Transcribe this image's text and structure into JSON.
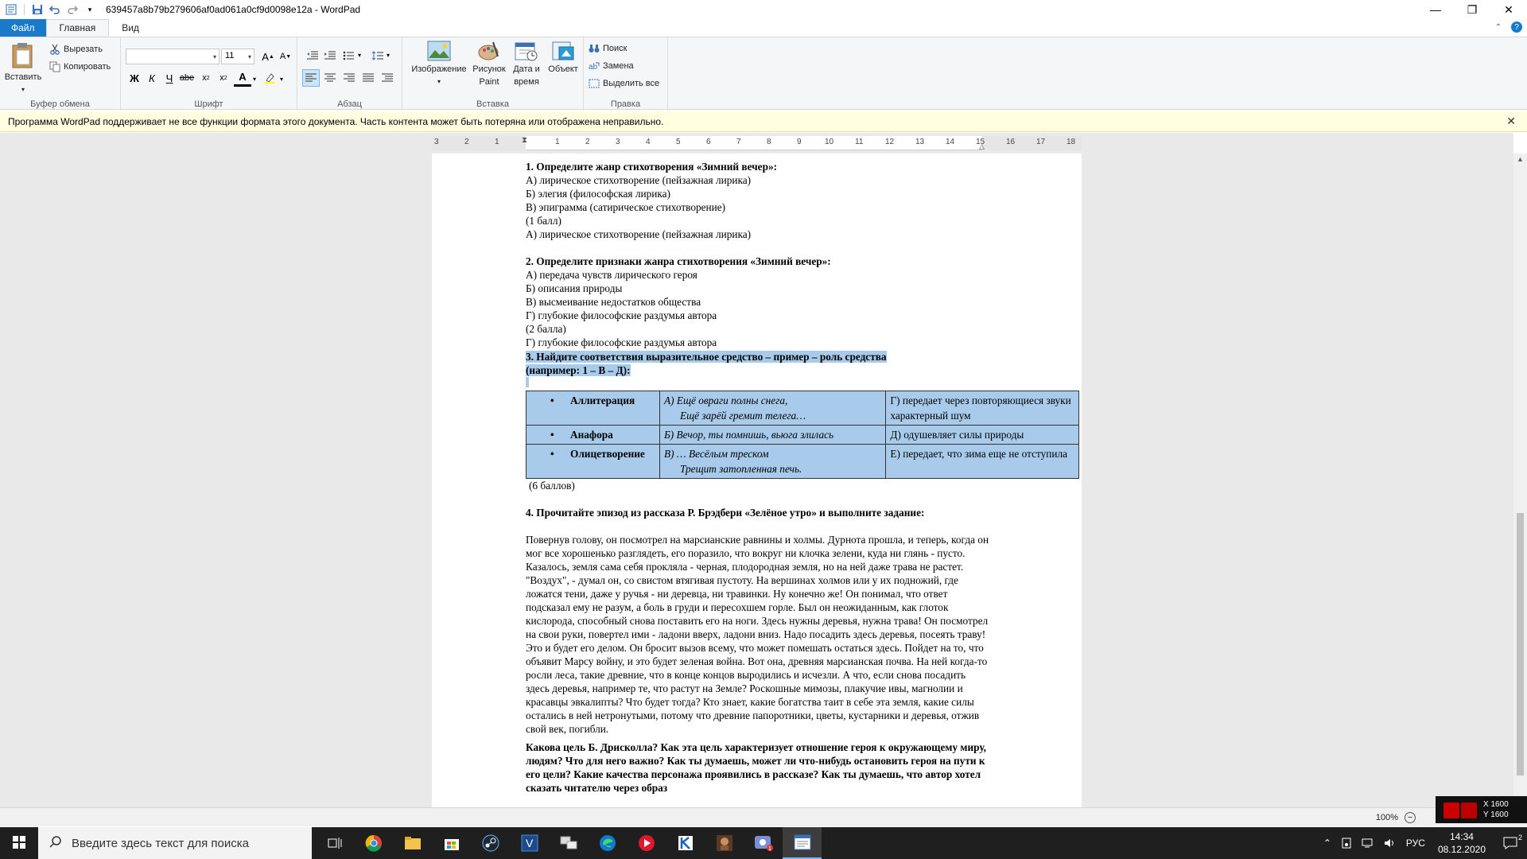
{
  "window": {
    "title": "639457a8b79b279606af0ad061a0cf9d0098e12a - WordPad"
  },
  "tabs": {
    "file": "Файл",
    "home": "Главная",
    "view": "Вид"
  },
  "ribbon": {
    "clipboard": {
      "label": "Буфер обмена",
      "paste": "Вставить",
      "cut": "Вырезать",
      "copy": "Копировать"
    },
    "font": {
      "label": "Шрифт",
      "font_name": "",
      "font_size": "11"
    },
    "paragraph": {
      "label": "Абзац"
    },
    "insert": {
      "label": "Вставка",
      "image": "Изображение",
      "paint_line1": "Рисунок",
      "paint_line2": "Paint",
      "date_line1": "Дата и",
      "date_line2": "время",
      "object": "Объект"
    },
    "editing": {
      "label": "Правка",
      "find": "Поиск",
      "replace": "Замена",
      "select_all": "Выделить все"
    }
  },
  "infobar": {
    "message": "Программа WordPad поддерживает не все функции формата этого документа. Часть контента может быть потеряна или отображена неправильно."
  },
  "ruler": {
    "left_numbers": [
      "3",
      "2",
      "1"
    ],
    "right_numbers": [
      "1",
      "2",
      "3",
      "4",
      "5",
      "6",
      "7",
      "8",
      "9",
      "10",
      "11",
      "12",
      "13",
      "14",
      "15",
      "16",
      "17",
      "18"
    ]
  },
  "document": {
    "q1": {
      "title": "1. Определите жанр стихотворения «Зимний вечер»:",
      "options": [
        "А) лирическое стихотворение (пейзажная лирика)",
        "Б) элегия (философская лирика)",
        "В) эпиграмма (сатирическое стихотворение)"
      ],
      "points": "(1 балл)",
      "answer": "А) лирическое стихотворение (пейзажная лирика)"
    },
    "q2": {
      "title": "2. Определите признаки жанра стихотворения «Зимний вечер»:",
      "options": [
        "А) передача чувств лирического героя",
        "Б) описания природы",
        "В) высмеивание недостатков общества",
        "Г) глубокие философские раздумья автора"
      ],
      "points": "(2 балла)",
      "answer": "Г) глубокие философские раздумья автора"
    },
    "q3": {
      "title_line1": "3. Найдите соответствия выразительное средство – пример – роль средства",
      "title_line2": "(например: 1 – В – Д):",
      "rows": [
        {
          "device": "Аллитерация",
          "example_line1": "А) Ещё овраги полны снега,",
          "example_line2": "Ещё зарёй гремит телега…",
          "role": "Г) передает через повторяющиеся звуки характерный шум"
        },
        {
          "device": "Анафора",
          "example_line1": "Б) Вечор, ты помнишь, вьюга злилась",
          "example_line2": "",
          "role": "Д) одушевляет силы природы"
        },
        {
          "device": "Олицетворение",
          "example_line1": "В) … Весёлым треском",
          "example_line2": "Трещит затопленная печь.",
          "role": "Е) передает, что зима еще не отступила"
        }
      ],
      "points": "(6 баллов)"
    },
    "q4": {
      "title": "4. Прочитайте эпизод из рассказа Р. Брэдбери «Зелёное утро» и выполните задание:",
      "text": "Повернув голову, он посмотрел на марсианские равнины  и холмы. Дурнота прошла, и теперь, когда он мог все хорошенько разглядеть, его поразило, что вокруг ни клочка зелени, куда ни глянь - пусто. Казалось, земля сама себя прокляла - черная, плодородная земля, но на ней даже трава не растет. \"Воздух\", - думал он, со свистом втягивая пустоту. На вершинах холмов или  у их подножий,  где ложатся тени, даже у ручья - ни деревца, ни травинки.  Ну конечно же! Он понимал, что ответ подсказал ему не разум, а боль в груди и пересохшем горле. Был он неожиданным, как глоток кислорода, способный снова поставить его на ноги. Здесь нужны деревья, нужна трава! Он посмотрел на свои руки, повертел ими - ладони вверх, ладони вниз.  Надо посадить здесь деревья, посеять траву! Это и будет его делом. Он бросит вызов всему, что может помешать остаться здесь. Пойдет на то, что объявит Марсу войну, и это будет зеленая война. Вот она, древняя марсианская почва. На ней когда-то росли леса, такие древние, что в конце концов выродились  и исчезли. А что, если снова посадить здесь деревья, например те, что растут на Земле? Роскошные мимозы, плакучие ивы, магнолии и красавцы эвкалипты? Что будет тогда? Кто знает, какие богатства таит в себе эта земля, какие силы остались в ней нетронутыми, потому что древние папоротники,  цветы, кустарники и деревья, отжив свой век, погибли.",
      "task": "Какова цель Б. Дрисколла? Как эта цель характеризует отношение героя к окружающему миру, людям? Что для него важно? Как ты думаешь, может ли что-нибудь остановить героя на пути к его цели? Какие качества персонажа проявились в рассказе? Как ты думаешь, что автор хотел сказать читателю через образ"
    }
  },
  "statusbar": {
    "zoom": "100%",
    "coord_x": "X 1600",
    "coord_y": "Y 1600"
  },
  "taskbar": {
    "search_placeholder": "Введите здесь текст для поиска",
    "lang": "РУС",
    "time": "14:34",
    "date": "08.12.2020",
    "notif_count": "2"
  }
}
